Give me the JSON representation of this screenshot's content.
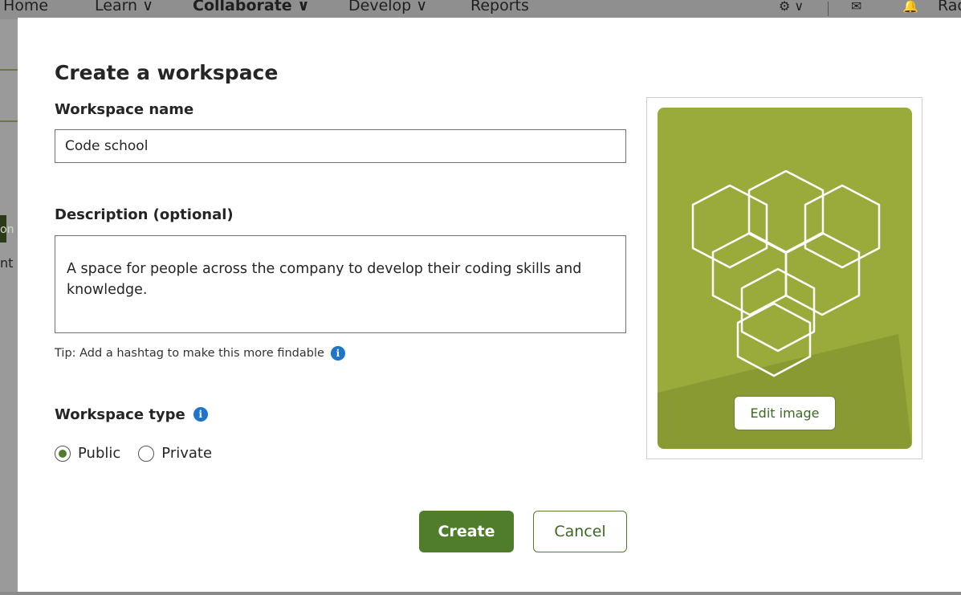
{
  "background_nav": {
    "items": [
      {
        "label": "Home"
      },
      {
        "label": "Learn ∨"
      },
      {
        "label": "Collaborate ∨"
      },
      {
        "label": "Develop ∨"
      },
      {
        "label": "Reports"
      }
    ],
    "user_fragment": "Rad",
    "left_fragment_1": "on",
    "left_fragment_2": "nt"
  },
  "modal": {
    "title": "Create a workspace",
    "name_label": "Workspace name",
    "name_value": "Code school",
    "description_label": "Description (optional)",
    "description_value": "A space for people across the company to develop their coding skills and knowledge.",
    "tip": "Tip: Add a hashtag to make this more findable",
    "type_label": "Workspace type",
    "type_options": [
      {
        "label": "Public",
        "selected": true
      },
      {
        "label": "Private",
        "selected": false
      }
    ],
    "edit_image_label": "Edit image",
    "create_label": "Create",
    "cancel_label": "Cancel"
  },
  "colors": {
    "accent": "#4f7d2b",
    "tile": "#9aab3b",
    "info": "#1f75c8"
  },
  "icons": [
    "gear-icon",
    "mail-icon",
    "bell-icon",
    "info-icon",
    "hexagon-pattern"
  ]
}
